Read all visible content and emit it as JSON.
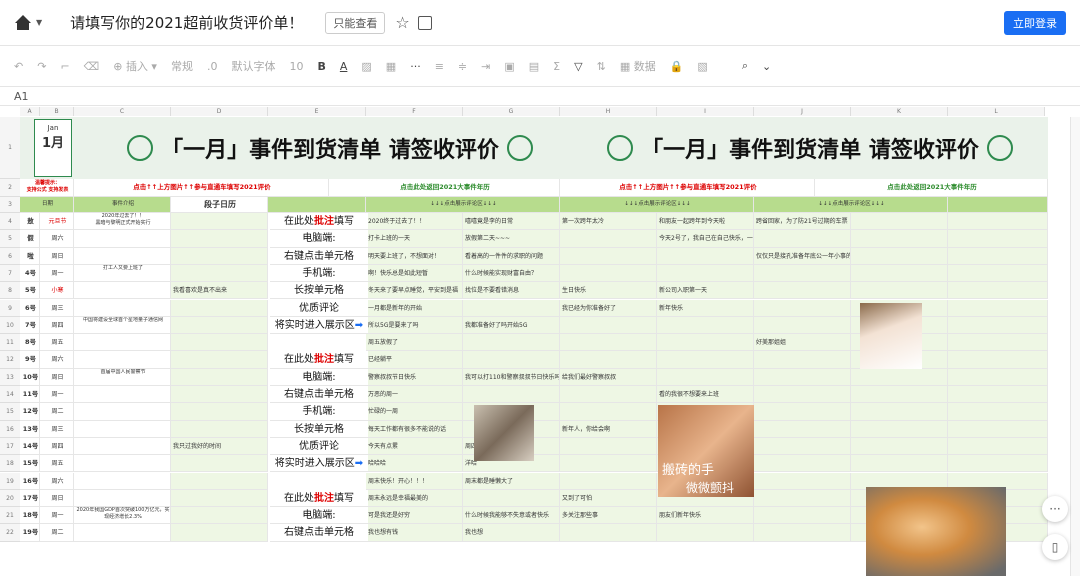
{
  "topbar": {
    "title": "请填写你的2021超前收货评价单！",
    "readonly": "只能查看",
    "login": "立即登录"
  },
  "toolbar": {
    "insert": "插入",
    "style": "常规",
    "decimal": ".0",
    "font": "默认字体",
    "size": "10",
    "data": "数据"
  },
  "formula": {
    "cell_ref": "A1"
  },
  "columns": [
    "A",
    "B",
    "C",
    "D",
    "E",
    "F",
    "G",
    "H",
    "I",
    "J",
    "K",
    "L"
  ],
  "banner": {
    "text": "「一月」事件到货清单  请签收评价",
    "jan_en": "Jan",
    "jan_cn": "1月"
  },
  "row2": {
    "left_note": "温馨提示：\n支持公式 支持发表",
    "link1": "点击↑↑上方图片↑↑参与直通车填写2021评价",
    "link2": "点击此处返回2021大事件年历"
  },
  "row3": {
    "date": "日期",
    "intro": "事件介绍",
    "calendar": "段子日历",
    "area": "↓↓↓点击展示评论区↓↓↓"
  },
  "rows": [
    {
      "n": "4",
      "a": "敖",
      "b": "元旦节",
      "c": "2020年过去了！！\n黑暗与黎明正式开始实行",
      "f": "2020终于过去了！！",
      "g": "嘻嘻竟是李的日常",
      "h": "第一次跨年太冷",
      "i": "和朋友一起跨年到今天啦",
      "j": "跨省回家，为了防21号过期的车票"
    },
    {
      "n": "5",
      "a": "假",
      "b": "周六",
      "f": "打卡上班的一天",
      "g": "放假第二天~~~",
      "i": "今天2号了，我自己在自己快乐，一切顺利，心想事成"
    },
    {
      "n": "6",
      "a": "啦",
      "b": "周日",
      "f": "明天要上班了，不想面对！",
      "g": "看着高的一件件的求职的问题",
      "j": "仅仅只是接孔准备年底公一年小事的周成这样"
    },
    {
      "n": "7",
      "a": "4号",
      "b": "周一",
      "c": "打工人又要上班了",
      "f": "啊！快乐总是如此短暂",
      "g": "什么时候能实现财富自由？"
    },
    {
      "n": "8",
      "a": "5号",
      "b": "小寒",
      "d": "我看喜欢是真不出来",
      "f": "冬天来了要早点睡觉，平安到是福",
      "g": "找位是不要看错消息",
      "h": "生日快乐",
      "i": "新公司入职第一天"
    },
    {
      "n": "9",
      "a": "6号",
      "b": "周三",
      "f": "一月都是新年的开始",
      "h": "我已经为你准备好了",
      "i": "新年快乐"
    },
    {
      "n": "10",
      "a": "7号",
      "b": "周四",
      "c": "中国将建设全球首个星地量子通信网",
      "f": "所以5G是要来了吗",
      "g": "我都准备好了吗开始5G"
    },
    {
      "n": "11",
      "a": "8号",
      "b": "周五",
      "f": "周五放假了",
      "j": "好美那姐姐"
    },
    {
      "n": "12",
      "a": "9号",
      "b": "周六",
      "f": "已经躺平"
    },
    {
      "n": "13",
      "a": "10号",
      "b": "周日",
      "c": "首届中国人民警察节",
      "f": "警察叔叔节日快乐",
      "g": "我可以打110和警察叔叔节日快乐吗？",
      "h": "给我们最好警察叔叔"
    },
    {
      "n": "14",
      "a": "11号",
      "b": "周一",
      "f": "万恶的周一",
      "i": "看的我很不想要来上班"
    },
    {
      "n": "15",
      "a": "12号",
      "b": "周二",
      "f": "忙碌的一周"
    },
    {
      "n": "16",
      "a": "13号",
      "b": "周三",
      "f": "每天工作都有很多不能说的话",
      "h": "新年人，你给会啊"
    },
    {
      "n": "17",
      "a": "14号",
      "b": "周四",
      "d": "我只过我好的时间",
      "f": "今天有点累",
      "g": "周四了！"
    },
    {
      "n": "18",
      "a": "15号",
      "b": "周五",
      "f": "哈哈哈",
      "g": "洋哈"
    },
    {
      "n": "19",
      "a": "16号",
      "b": "周六",
      "f": "周末快乐！开心！！！",
      "g": "周末都是睡懒大了"
    },
    {
      "n": "20",
      "a": "17号",
      "b": "周日",
      "f": "周末永远是幸福最美的",
      "h": "又到了可怕"
    },
    {
      "n": "21",
      "a": "18号",
      "b": "周一",
      "c": "2020年我国GDP首次突破100万亿元，实现经济增长2.3%",
      "f": "可是我还是好穷",
      "g": "什么时候我能够不失意或者快乐",
      "h": "多关注那些事",
      "i": "朋友们新年快乐"
    },
    {
      "n": "22",
      "a": "19号",
      "b": "周二",
      "f": "我也想有钱",
      "g": "我也想"
    }
  ],
  "actions": [
    {
      "row": "4",
      "pre": "在此处",
      "hl": "批注",
      "post": "填写"
    },
    {
      "row": "5",
      "pre": "电脑端:",
      "hl": "",
      "post": ""
    },
    {
      "row": "6",
      "pre": "右键点击单元格",
      "hl": "",
      "post": ""
    },
    {
      "row": "7",
      "pre": "手机端:",
      "hl": "",
      "post": ""
    },
    {
      "row": "8",
      "pre": "长按单元格",
      "hl": "",
      "post": ""
    },
    {
      "row": "9",
      "pre": "优质评论",
      "hl": "",
      "post": ""
    },
    {
      "row": "10",
      "pre": "将实时进入展示区",
      "hl": "",
      "post": "➡"
    },
    {
      "row": "12",
      "pre": "在此处",
      "hl": "批注",
      "post": "填写"
    },
    {
      "row": "13",
      "pre": "电脑端:",
      "hl": "",
      "post": ""
    },
    {
      "row": "14",
      "pre": "右键点击单元格",
      "hl": "",
      "post": ""
    },
    {
      "row": "15",
      "pre": "手机端:",
      "hl": "",
      "post": ""
    },
    {
      "row": "16",
      "pre": "长按单元格",
      "hl": "",
      "post": ""
    },
    {
      "row": "17",
      "pre": "优质评论",
      "hl": "",
      "post": ""
    },
    {
      "row": "18",
      "pre": "将实时进入展示区",
      "hl": "",
      "post": "➡"
    },
    {
      "row": "20",
      "pre": "在此处",
      "hl": "批注",
      "post": "填写"
    },
    {
      "row": "21",
      "pre": "电脑端:",
      "hl": "",
      "post": ""
    },
    {
      "row": "22",
      "pre": "右键点击单元格",
      "hl": "",
      "post": ""
    }
  ],
  "photos": {
    "brick_caption1": "搬砖的手",
    "brick_caption2": "微微颤抖"
  }
}
